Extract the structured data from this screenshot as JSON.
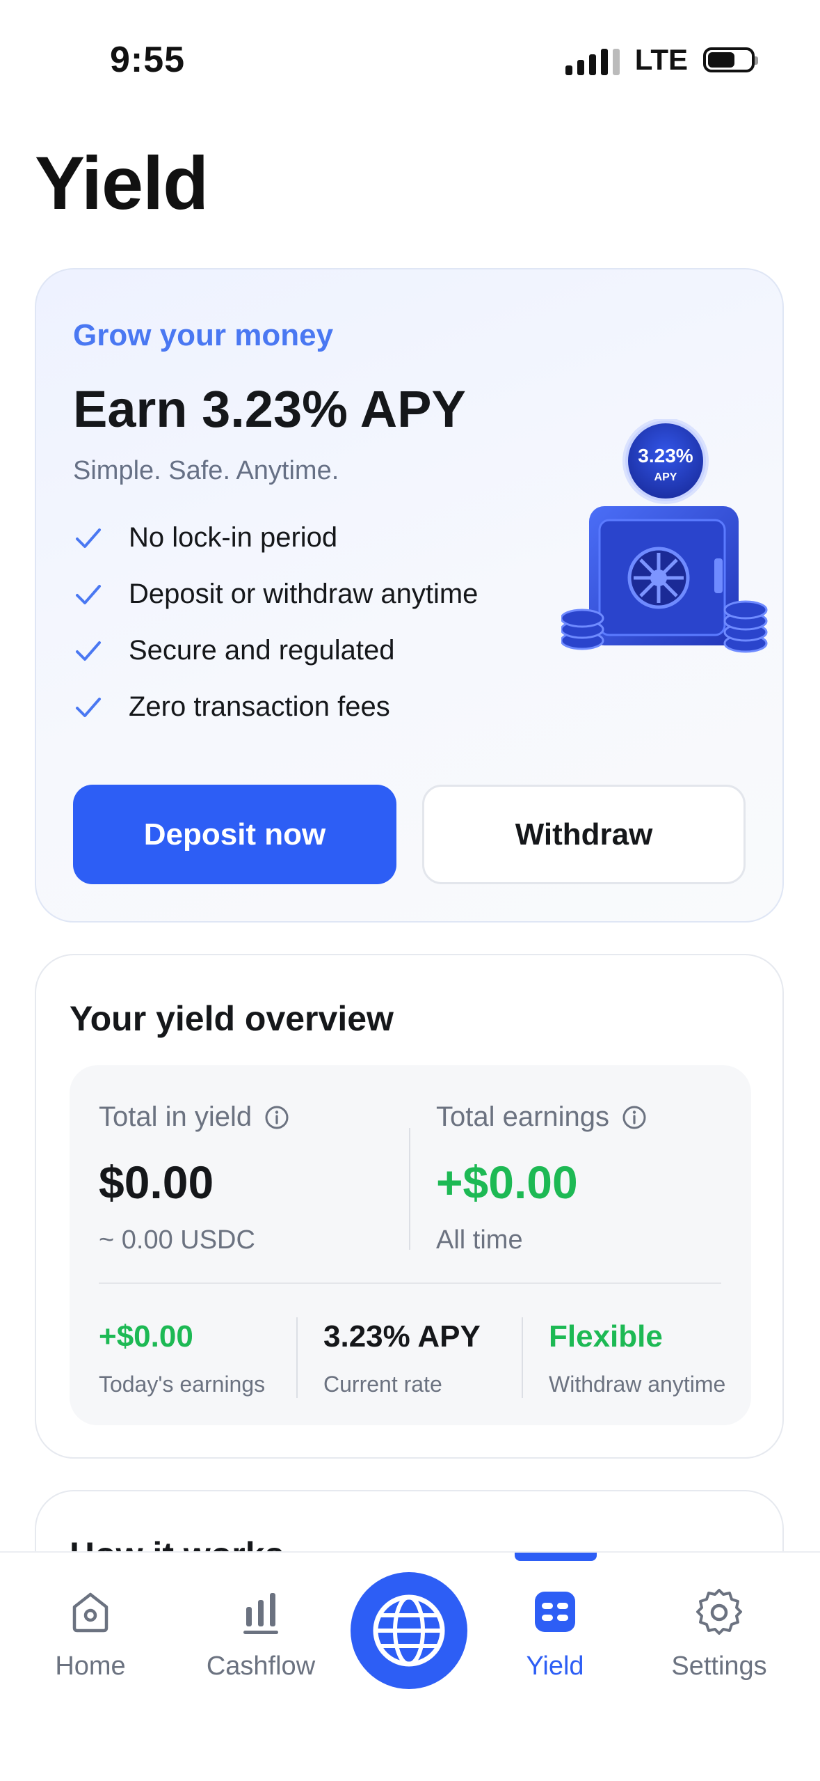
{
  "status_bar": {
    "time": "9:55",
    "network": "LTE"
  },
  "page": {
    "title": "Yield"
  },
  "hero": {
    "eyebrow": "Grow your money",
    "title": "Earn 3.23% APY",
    "subtitle": "Simple. Safe. Anytime.",
    "features": [
      "No lock-in period",
      "Deposit or withdraw anytime",
      "Secure and regulated",
      "Zero transaction fees"
    ],
    "badge_rate": "3.23%",
    "badge_label": "APY",
    "deposit_label": "Deposit now",
    "withdraw_label": "Withdraw"
  },
  "overview": {
    "title": "Your yield overview",
    "total_in_yield_label": "Total in yield",
    "total_in_yield_value": "$0.00",
    "total_in_yield_sub": "~ 0.00 USDC",
    "total_earnings_label": "Total earnings",
    "total_earnings_value": "+$0.00",
    "total_earnings_sub": "All time",
    "today_value": "+$0.00",
    "today_label": "Today's earnings",
    "rate_value": "3.23% APY",
    "rate_label": "Current rate",
    "flex_value": "Flexible",
    "flex_label": "Withdraw anytime"
  },
  "how_it_works": {
    "title": "How it works"
  },
  "tabs": [
    {
      "label": "Home",
      "icon": "home-icon"
    },
    {
      "label": "Cashflow",
      "icon": "bar-chart-icon"
    },
    {
      "label": "",
      "icon": "globe-icon"
    },
    {
      "label": "Yield",
      "icon": "yield-icon"
    },
    {
      "label": "Settings",
      "icon": "gear-icon"
    }
  ],
  "colors": {
    "accent": "#2d5ef5",
    "eyebrow": "#4a78f2",
    "positive": "#1db954"
  }
}
